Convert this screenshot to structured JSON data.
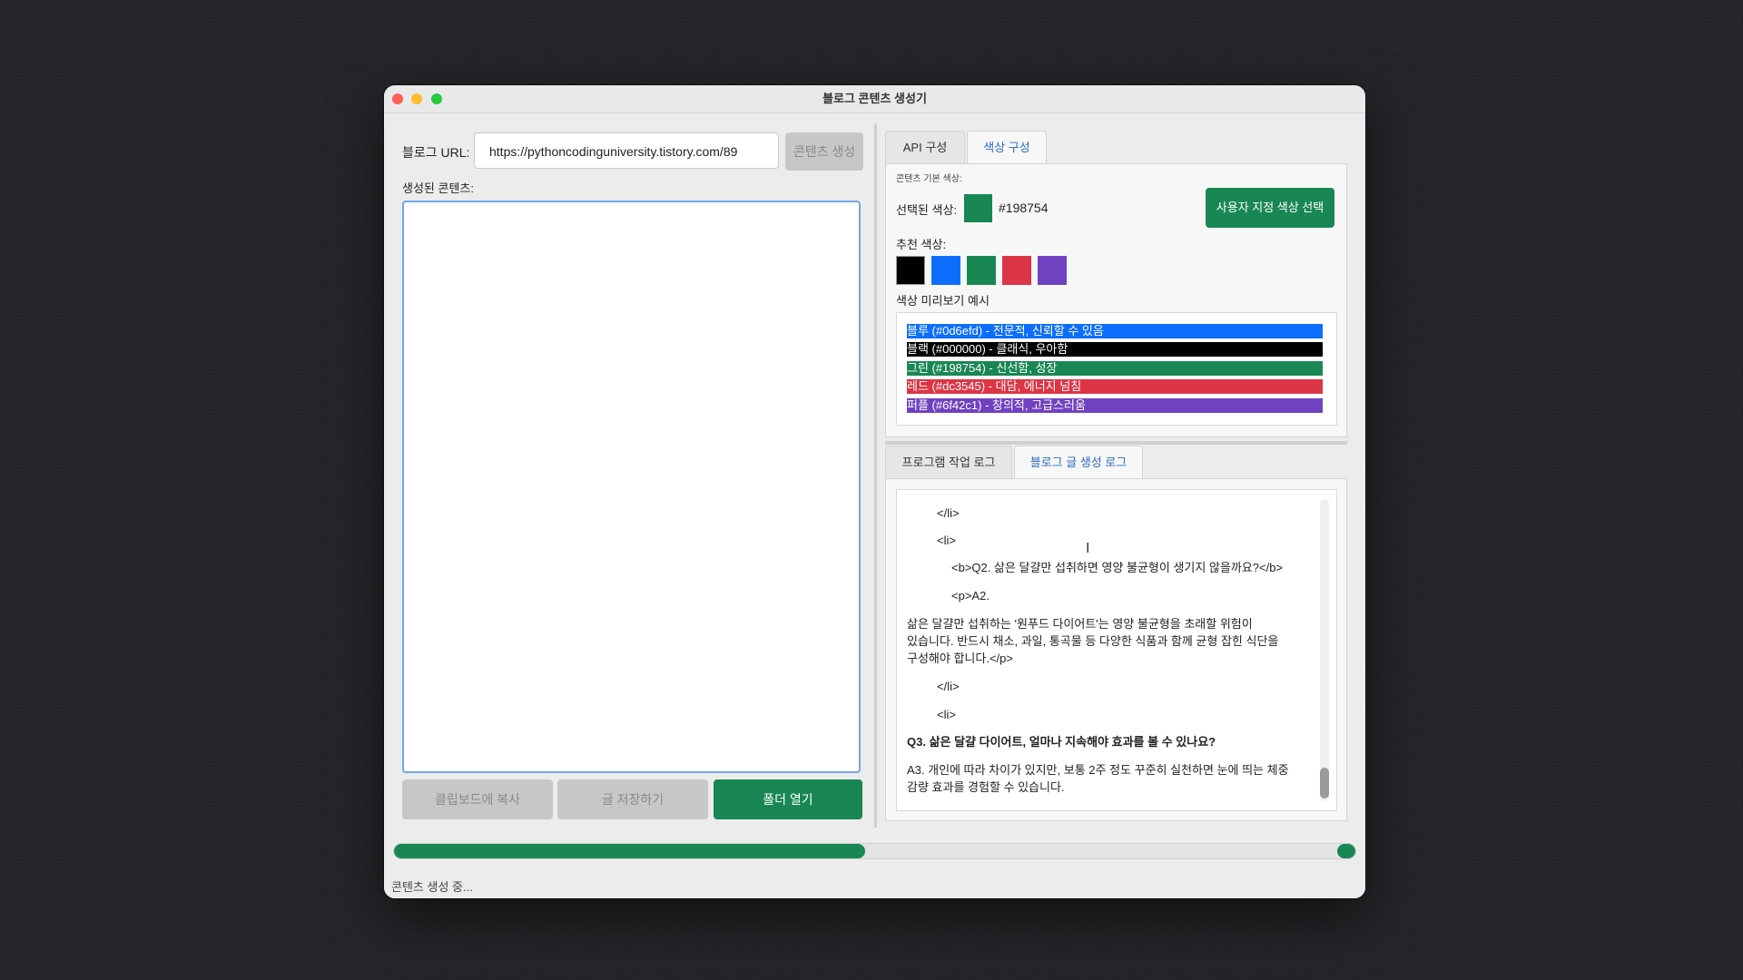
{
  "window": {
    "title": "블로그 콘텐츠 생성기"
  },
  "left": {
    "url_label": "블로그 URL:",
    "url_value": "https://pythoncodinguniversity.tistory.com/89",
    "generate_button": "콘텐츠 생성",
    "content_label": "생성된 콘텐츠:",
    "content_value": "",
    "copy_button": "클립보드에 복사",
    "save_button": "글 저장하기",
    "open_folder_button": "폴더 열기"
  },
  "settings_tabs": {
    "tabs": [
      {
        "label": "API 구성",
        "active": false
      },
      {
        "label": "색상 구성",
        "active": true
      }
    ]
  },
  "color_config": {
    "section_title": "콘텐츠 기본 색상:",
    "selected_label": "선택된 색상:",
    "selected_hex": "#198754",
    "custom_button": "사용자 지정 색상 선택",
    "recommended_label": "추천 색상:",
    "recommended_colors": [
      "#000000",
      "#0d6efd",
      "#198754",
      "#dc3545",
      "#6f42c1"
    ],
    "preview_label": "색상 미리보기 예시",
    "preview_rows": [
      {
        "text": "블루 (#0d6efd) - 전문적, 신뢰할 수 있음",
        "color": "#0d6efd"
      },
      {
        "text": "블랙 (#000000) - 클래식, 우아함",
        "color": "#000000"
      },
      {
        "text": "그린 (#198754) - 신선함, 성장",
        "color": "#198754"
      },
      {
        "text": "레드 (#dc3545) - 대담, 에너지 넘침",
        "color": "#dc3545"
      },
      {
        "text": "퍼플 (#6f42c1) - 창의적, 고급스러움",
        "color": "#6f42c1"
      }
    ]
  },
  "log_tabs": {
    "tabs": [
      {
        "label": "프로그램 작업 로그",
        "active": false
      },
      {
        "label": "블로그 글 생성 로그",
        "active": true
      }
    ]
  },
  "log": {
    "lines": [
      "</li>",
      "<li>",
      "<b>Q2. 삶은 달걀만 섭취하면 영양 불균형이 생기지 않을까요?</b>",
      "<p>A2.",
      " 삶은 달걀만 섭취하는 '원푸드 다이어트'는 영양 불균형을 초래할 위험이",
      "있습니다. 반드시 채소, 과일, 통곡물 등 다양한 식품과 함께 균형 잡힌 식단을",
      "구성해야 합니다.</p>",
      "</li>",
      "<li>",
      "Q3. 삶은 달걀 다이어트, 얼마나 지속해야 효과를 볼 수 있나요?",
      "A3. 개인에 따라 차이가 있지만, 보통 2주 정도 꾸준히 실천하면 눈에 띄는 체중",
      "감량 효과를 경험할 수 있습니다."
    ]
  },
  "progress": {
    "value": 0.49
  },
  "status": {
    "text": "콘텐츠 생성 중..."
  },
  "colors": {
    "accent": "#198754",
    "tab_active_text": "#2b6cc4",
    "disabled_button": "#c7c7c7"
  }
}
